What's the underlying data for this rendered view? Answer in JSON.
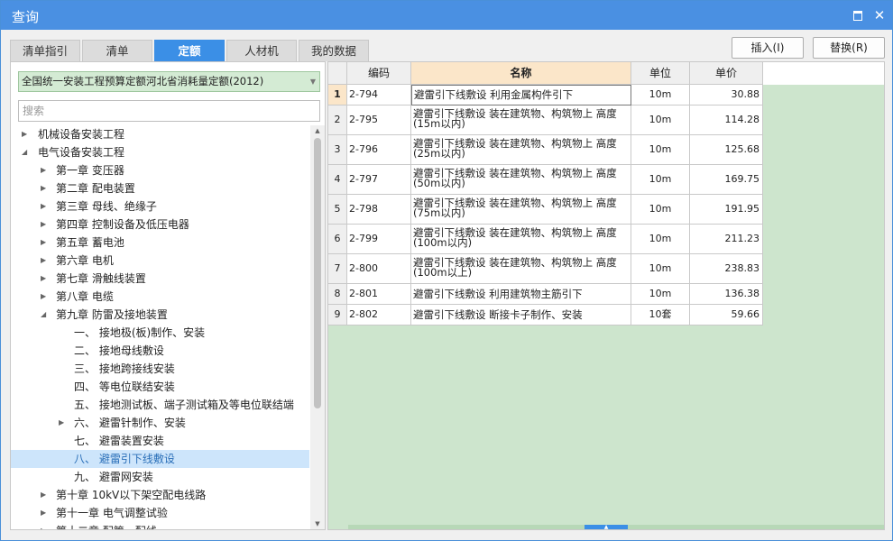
{
  "window": {
    "title": "查询"
  },
  "tabs": [
    {
      "label": "清单指引"
    },
    {
      "label": "清单"
    },
    {
      "label": "定额"
    },
    {
      "label": "人材机"
    },
    {
      "label": "我的数据"
    }
  ],
  "active_tab": "定额",
  "buttons": {
    "insert": "插入(I)",
    "replace": "替换(R)"
  },
  "library_select": "全国统一安装工程预算定额河北省消耗量定额(2012)",
  "search_placeholder": "搜索",
  "tree": [
    {
      "label": "机械设备安装工程",
      "expanded": false
    },
    {
      "label": "电气设备安装工程",
      "expanded": true
    },
    {
      "label": "第一章 变压器",
      "expanded": false
    },
    {
      "label": "第二章 配电装置",
      "expanded": false
    },
    {
      "label": "第三章 母线、绝缘子",
      "expanded": false
    },
    {
      "label": "第四章 控制设备及低压电器",
      "expanded": false
    },
    {
      "label": "第五章 蓄电池",
      "expanded": false
    },
    {
      "label": "第六章 电机",
      "expanded": false
    },
    {
      "label": "第七章 滑触线装置",
      "expanded": false
    },
    {
      "label": "第八章 电缆",
      "expanded": false
    },
    {
      "label": "第九章 防雷及接地装置",
      "expanded": true
    },
    {
      "label": "一、 接地极(板)制作、安装"
    },
    {
      "label": "二、 接地母线敷设"
    },
    {
      "label": "三、 接地跨接线安装"
    },
    {
      "label": "四、 等电位联结安装"
    },
    {
      "label": "五、 接地测试板、端子测试箱及等电位联结端"
    },
    {
      "label": "六、 避雷针制作、安装",
      "expanded": false
    },
    {
      "label": "七、 避雷装置安装"
    },
    {
      "label": "八、 避雷引下线敷设",
      "selected": true
    },
    {
      "label": "九、 避雷网安装"
    },
    {
      "label": "第十章 10kV以下架空配电线路",
      "expanded": false
    },
    {
      "label": "第十一章 电气调整试验",
      "expanded": false
    },
    {
      "label": "第十二章 配管、配线",
      "expanded": false
    }
  ],
  "grid": {
    "columns": [
      "编码",
      "名称",
      "单位",
      "单价"
    ],
    "rows": [
      {
        "idx": "1",
        "code": "2-794",
        "name": "避雷引下线敷设 利用金属构件引下",
        "unit": "10m",
        "price": "30.88"
      },
      {
        "idx": "2",
        "code": "2-795",
        "name": "避雷引下线敷设 装在建筑物、构筑物上 高度(15m以内)",
        "unit": "10m",
        "price": "114.28"
      },
      {
        "idx": "3",
        "code": "2-796",
        "name": "避雷引下线敷设 装在建筑物、构筑物上 高度(25m以内)",
        "unit": "10m",
        "price": "125.68"
      },
      {
        "idx": "4",
        "code": "2-797",
        "name": "避雷引下线敷设 装在建筑物、构筑物上 高度(50m以内)",
        "unit": "10m",
        "price": "169.75"
      },
      {
        "idx": "5",
        "code": "2-798",
        "name": "避雷引下线敷设 装在建筑物、构筑物上 高度(75m以内)",
        "unit": "10m",
        "price": "191.95"
      },
      {
        "idx": "6",
        "code": "2-799",
        "name": "避雷引下线敷设 装在建筑物、构筑物上 高度(100m以内)",
        "unit": "10m",
        "price": "211.23"
      },
      {
        "idx": "7",
        "code": "2-800",
        "name": "避雷引下线敷设 装在建筑物、构筑物上 高度(100m以上)",
        "unit": "10m",
        "price": "238.83"
      },
      {
        "idx": "8",
        "code": "2-801",
        "name": "避雷引下线敷设 利用建筑物主筋引下",
        "unit": "10m",
        "price": "136.38"
      },
      {
        "idx": "9",
        "code": "2-802",
        "name": "避雷引下线敷设 断接卡子制作、安装",
        "unit": "10套",
        "price": "59.66"
      }
    ]
  },
  "colors": {
    "titlebar": "#4a90e2",
    "active_tab": "#3b8fe6",
    "grid_bg": "#cde5cd",
    "header_name": "#fbe6c9"
  }
}
